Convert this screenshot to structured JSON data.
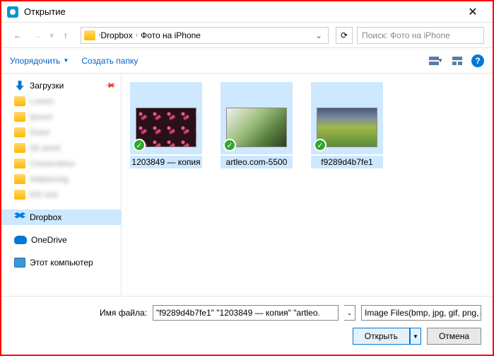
{
  "title": "Открытие",
  "breadcrumb": {
    "seg1": "Dropbox",
    "seg2": "Фото на iPhone"
  },
  "search": {
    "placeholder": "Поиск: Фото на iPhone"
  },
  "toolbar": {
    "organize": "Упорядочить",
    "newfolder": "Создать папку"
  },
  "tree": {
    "downloads": "Загрузки",
    "b1": "Lorem",
    "b2": "Ipsum",
    "b3": "Dolor",
    "b4": "Sit amet",
    "b5": "Consectetur",
    "b6": "Adipiscing",
    "b7": "Elit sed",
    "dropbox": "Dropbox",
    "onedrive": "OneDrive",
    "computer": "Этот компьютер"
  },
  "files": {
    "f1": "1203849 — копия",
    "f2": "artleo.com-5500",
    "f3": "f9289d4b7fe1"
  },
  "filename": {
    "label": "Имя файла:",
    "value": "\"f9289d4b7fe1\" \"1203849 — копия\" \"artleo."
  },
  "filter": "Image Files(bmp, jpg, gif, png,",
  "buttons": {
    "open": "Открыть",
    "cancel": "Отмена"
  }
}
